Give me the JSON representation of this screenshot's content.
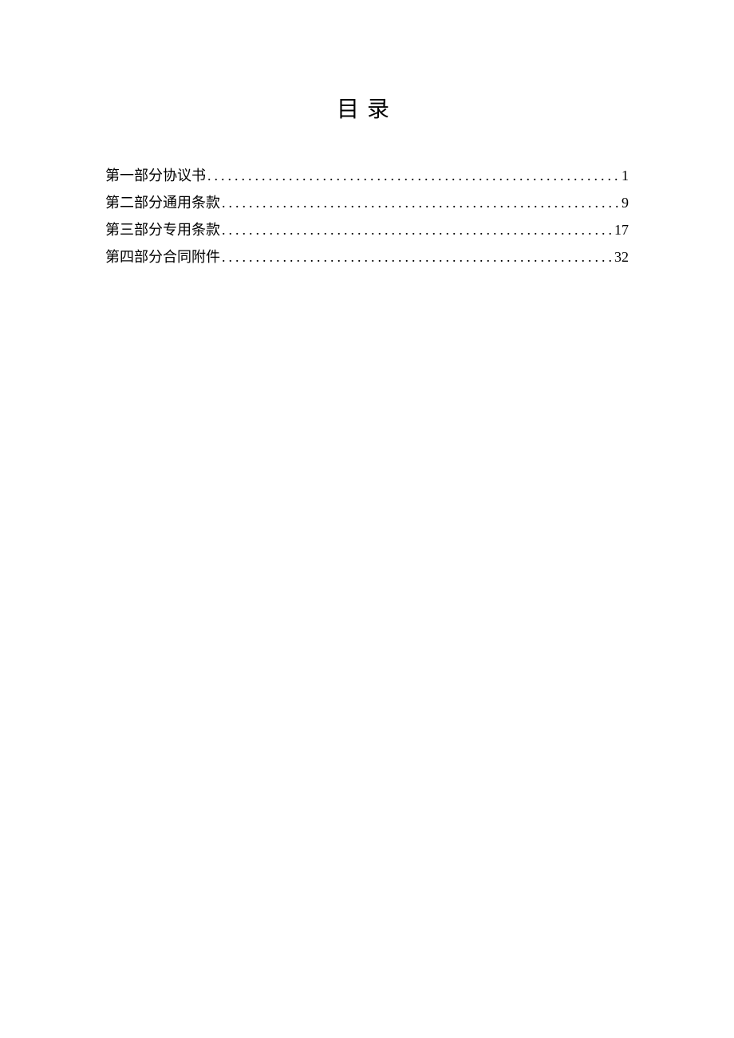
{
  "title": "目录",
  "toc": {
    "entries": [
      {
        "label": "第一部分协议书",
        "page": "1"
      },
      {
        "label": "第二部分通用条款",
        "page": "9"
      },
      {
        "label": "第三部分专用条款",
        "page": "17"
      },
      {
        "label": "第四部分合同附件",
        "page": "32"
      }
    ]
  }
}
